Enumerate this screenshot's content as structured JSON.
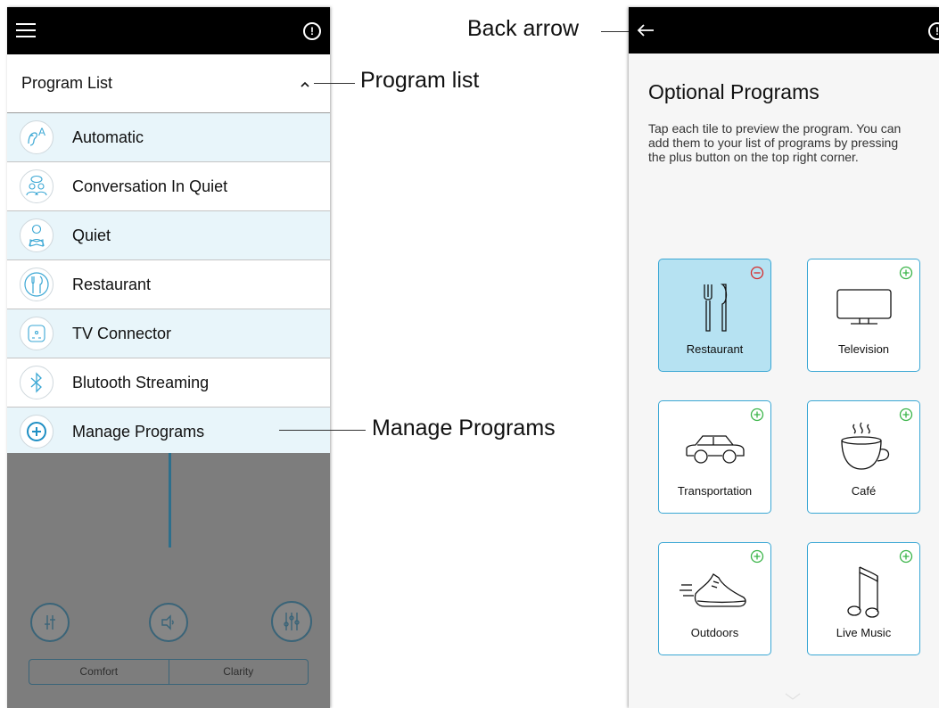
{
  "left_screen": {
    "program_header": {
      "title": "Program List"
    },
    "programs": [
      {
        "label": "Automatic",
        "icon": "automatic-icon",
        "tint": true
      },
      {
        "label": "Conversation In Quiet",
        "icon": "conversation-icon",
        "tint": false
      },
      {
        "label": "Quiet",
        "icon": "quiet-reading-icon",
        "tint": true
      },
      {
        "label": "Restaurant",
        "icon": "restaurant-icon",
        "tint": false
      },
      {
        "label": "TV Connector",
        "icon": "tv-connector-icon",
        "tint": true
      },
      {
        "label": "Blutooth Streaming",
        "icon": "bluetooth-icon",
        "tint": false
      },
      {
        "label": "Manage Programs",
        "icon": "add-circle-icon",
        "tint": true
      }
    ],
    "segmented": {
      "left": "Comfort",
      "right": "Clarity"
    }
  },
  "callouts": {
    "back_arrow": "Back arrow",
    "program_list": "Program list",
    "manage_programs": "Manage Programs"
  },
  "right_screen": {
    "title": "Optional Programs",
    "description": "Tap each tile to preview the program. You can add them to your list of programs by pressing the plus button on the top right corner.",
    "tiles": [
      {
        "label": "Restaurant",
        "icon": "restaurant-icon",
        "action": "remove",
        "selected": true
      },
      {
        "label": "Television",
        "icon": "television-icon",
        "action": "add",
        "selected": false
      },
      {
        "label": "Transportation",
        "icon": "car-icon",
        "action": "add",
        "selected": false
      },
      {
        "label": "Café",
        "icon": "coffee-cup-icon",
        "action": "add",
        "selected": false
      },
      {
        "label": "Outdoors",
        "icon": "running-shoe-icon",
        "action": "add",
        "selected": false
      },
      {
        "label": "Live Music",
        "icon": "music-note-icon",
        "action": "add",
        "selected": false
      }
    ]
  },
  "colors": {
    "accent_blue": "#3aa7d4",
    "list_tint": "#e8f5fa",
    "add_green": "#3cb54a",
    "remove_red": "#d62b2b",
    "overlay_gray": "#7d7d7d"
  }
}
